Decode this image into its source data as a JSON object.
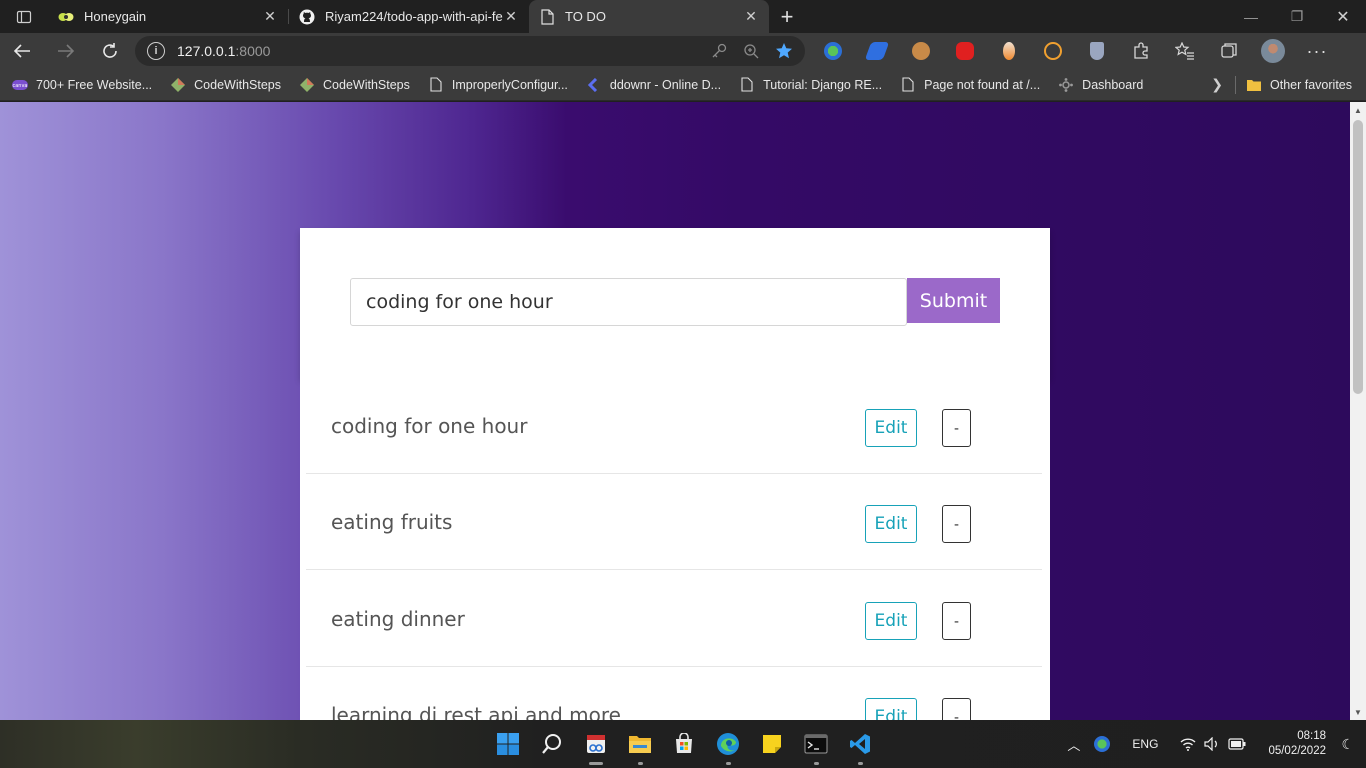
{
  "browser": {
    "tabs": [
      {
        "title": "Honeygain",
        "active": false
      },
      {
        "title": "Riyam224/todo-app-with-api-fe",
        "active": false
      },
      {
        "title": "TO DO",
        "active": true
      }
    ],
    "address": {
      "host": "127.0.0.1",
      "port": ":8000"
    },
    "bookmarks": [
      "700+ Free Website...",
      "CodeWithSteps",
      "CodeWithSteps",
      "ImproperlyConfigur...",
      "ddownr - Online D...",
      "Tutorial: Django RE...",
      "Page not found at /...",
      "Dashboard"
    ],
    "other_favorites": "Other favorites"
  },
  "app": {
    "input_value": "coding for one hour",
    "submit_label": "Submit",
    "edit_label": "Edit",
    "delete_label": "-",
    "tasks": [
      "coding for one hour",
      "eating fruits",
      "eating dinner",
      "learning dj rest api and more"
    ]
  },
  "taskbar": {
    "language": "ENG",
    "time": "08:18",
    "date": "05/02/2022"
  },
  "colors": {
    "submit": "#9b69c9",
    "edit": "#17a2b8",
    "page_bg": "#340a66"
  }
}
